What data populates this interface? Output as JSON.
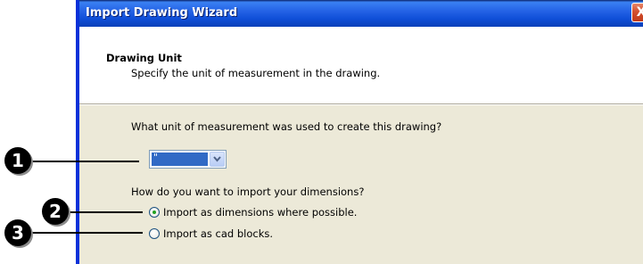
{
  "window": {
    "title": "Import Drawing Wizard",
    "close_glyph": "X"
  },
  "header": {
    "title": "Drawing Unit",
    "subtitle": "Specify the unit of measurement in the drawing."
  },
  "unit": {
    "question": "What unit of measurement was used to create this drawing?",
    "selected_value": "\"",
    "dropdown_icon": "chevron-down-icon"
  },
  "import_mode": {
    "question": "How do you want to import your dimensions?",
    "options": [
      {
        "label": "Import as dimensions where possible.",
        "selected": true
      },
      {
        "label": "Import as cad blocks.",
        "selected": false
      }
    ]
  },
  "callouts": [
    "1",
    "2",
    "3"
  ],
  "colors": {
    "titlebar": "#2563e6",
    "selection": "#316ac5",
    "radio_dot": "#21a121",
    "close_button": "#d4502f"
  }
}
